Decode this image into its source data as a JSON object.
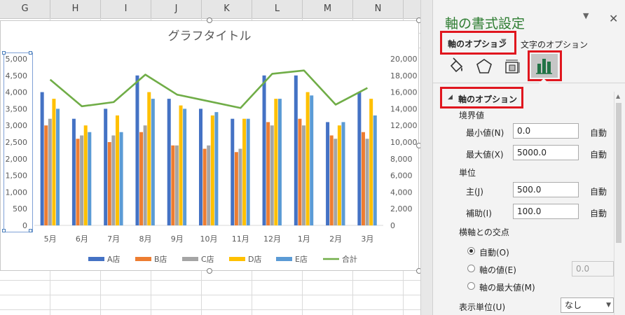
{
  "sheet": {
    "columns": [
      "G",
      "H",
      "I",
      "J",
      "K",
      "L",
      "M",
      "N"
    ]
  },
  "chart_data": {
    "type": "bar",
    "title": "グラフタイトル",
    "categories": [
      "5月",
      "6月",
      "7月",
      "8月",
      "9月",
      "10月",
      "11月",
      "12月",
      "1月",
      "2月",
      "3月"
    ],
    "series": [
      {
        "name": "A店",
        "color": "#4472c4",
        "values": [
          4000,
          3200,
          3500,
          4500,
          3800,
          3500,
          3200,
          4500,
          4500,
          3100,
          4000
        ]
      },
      {
        "name": "B店",
        "color": "#ed7d31",
        "values": [
          3000,
          2600,
          2500,
          2800,
          2400,
          2300,
          2200,
          3100,
          3200,
          2700,
          2800
        ]
      },
      {
        "name": "C店",
        "color": "#a5a5a5",
        "values": [
          3200,
          2700,
          2700,
          3000,
          2400,
          2400,
          2300,
          3000,
          3000,
          2600,
          2600
        ]
      },
      {
        "name": "D店",
        "color": "#ffc000",
        "values": [
          3800,
          3000,
          3300,
          4000,
          3600,
          3300,
          3200,
          3800,
          4000,
          3000,
          3800
        ]
      },
      {
        "name": "E店",
        "color": "#5b9bd5",
        "values": [
          3500,
          2800,
          2800,
          3800,
          3500,
          3400,
          3200,
          3800,
          3900,
          3100,
          3300
        ]
      },
      {
        "name": "合計",
        "type": "line",
        "axis": "secondary",
        "color": "#70ad47",
        "values": [
          17500,
          14300,
          14800,
          18100,
          15700,
          14900,
          14100,
          18200,
          18600,
          14500,
          16500
        ]
      }
    ],
    "y_ticks": [
      "0",
      "500",
      "1,000",
      "1,500",
      "2,000",
      "2,500",
      "3,000",
      "3,500",
      "4,000",
      "4,500",
      "5,000"
    ],
    "y2_ticks": [
      "0",
      "2,000",
      "4,000",
      "6,000",
      "8,000",
      "10,000",
      "12,000",
      "14,000",
      "16,000",
      "18,000",
      "20,000"
    ],
    "ylim": [
      0,
      5000
    ],
    "y2lim": [
      0,
      20000
    ],
    "legend_position": "bottom",
    "grid": false
  },
  "pane": {
    "title": "軸の書式設定",
    "tab_axis_options": "軸のオプション",
    "tab_text_options": "文字のオプション",
    "section_title": "軸のオプション",
    "bounds_label": "境界値",
    "min_label": "最小値(N)",
    "min_value": "0.0",
    "max_label": "最大値(X)",
    "max_value": "5000.0",
    "auto": "自動",
    "units_label": "単位",
    "major_label": "主(J)",
    "major_value": "500.0",
    "minor_label": "補助(I)",
    "minor_value": "100.0",
    "cross_label": "横軸との交点",
    "radio_auto": "自動(O)",
    "radio_value": "軸の値(E)",
    "radio_value_field": "0.0",
    "radio_max": "軸の最大値(M)",
    "display_units_label": "表示単位(U)",
    "display_units_value": "なし"
  }
}
